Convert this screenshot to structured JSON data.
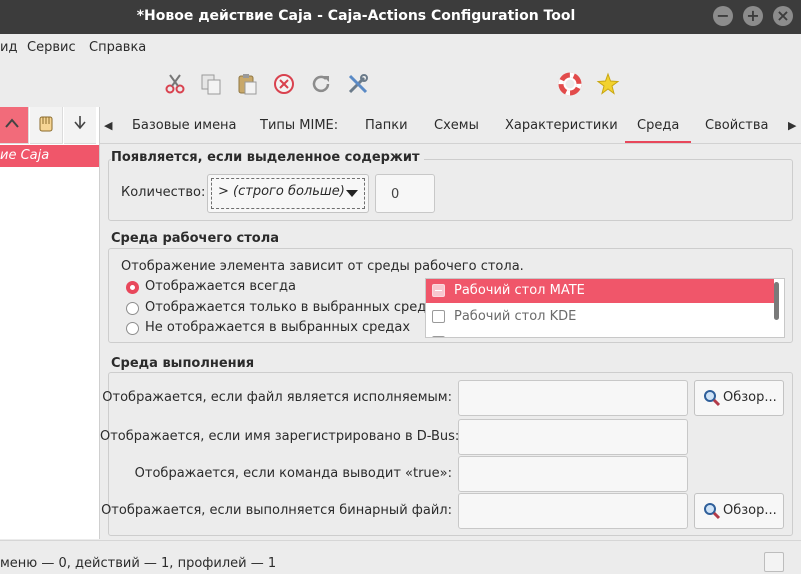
{
  "window": {
    "title": "*Новое действие Caja - Caja-Actions Configuration Tool",
    "controls": {
      "minimize": "−",
      "maximize": "+",
      "close": "×"
    }
  },
  "menubar": {
    "items": [
      "ид",
      "Сервис",
      "Справка"
    ]
  },
  "toolbar": {
    "icons": [
      "scissors-icon",
      "copy-icon",
      "paste-icon",
      "delete-icon",
      "reload-icon",
      "tools-icon",
      "help-icon",
      "about-icon"
    ]
  },
  "left_pane": {
    "selected_item": "ие Caja"
  },
  "tabs": {
    "left_arrow": "◀",
    "right_arrow": "▶",
    "items": [
      "Базовые имена",
      "Типы MIME:",
      "Папки",
      "Схемы",
      "Характеристики",
      "Среда",
      "Свойства"
    ],
    "active": "Среда"
  },
  "selection": {
    "title": "Появляется, если выделенное содержит",
    "count_label": "Количество:",
    "operator_value": "> (строго больше)",
    "count_value": "0"
  },
  "desktop": {
    "title": "Среда рабочего стола",
    "description": "Отображение элемента зависит от среды рабочего стола.",
    "radios": [
      {
        "label": "Отображается всегда",
        "checked": true
      },
      {
        "label": "Отображается только в выбранных средах",
        "checked": false
      },
      {
        "label": "Не отображается в выбранных средах",
        "checked": false
      }
    ],
    "environments": [
      {
        "label": "Рабочий стол MATE",
        "selected": true
      },
      {
        "label": "Рабочий стол KDE",
        "selected": false
      }
    ]
  },
  "runtime": {
    "title": "Среда выполнения",
    "rows": [
      {
        "label": "Отображается, если файл является исполняемым:",
        "value": "",
        "browse": "Обзор..."
      },
      {
        "label": "Отображается, если имя зарегистрировано в D-Bus:",
        "value": ""
      },
      {
        "label": "Отображается, если команда выводит «true»:",
        "value": ""
      },
      {
        "label": "Отображается, если выполняется бинарный файл:",
        "value": "",
        "browse": "Обзор..."
      }
    ]
  },
  "statusbar": {
    "text": "меню — 0, действий — 1, профилей — 1"
  },
  "colors": {
    "accent": "#e8475b",
    "selection": "#f0566a",
    "titlebar": "#3c3c3c",
    "background": "#ececec"
  }
}
